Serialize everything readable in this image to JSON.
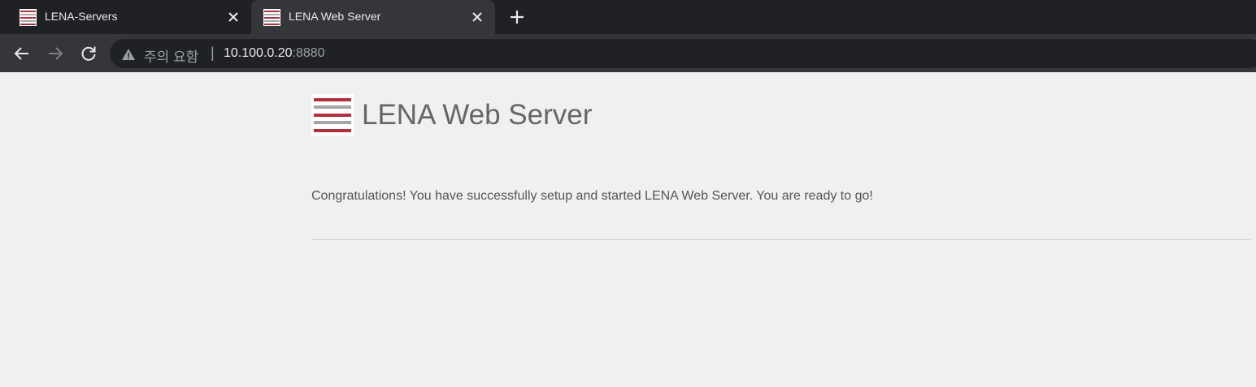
{
  "browser": {
    "tabs": [
      {
        "title": "LENA-Servers",
        "active": false,
        "favicon": "lena-logo-icon"
      },
      {
        "title": "LENA Web Server",
        "active": true,
        "favicon": "lena-logo-icon"
      }
    ],
    "address_bar": {
      "security_label": "주의 요함",
      "separator": "|",
      "url_host": "10.100.0.20",
      "url_port": ":8880"
    },
    "colors": {
      "tabbar_bg": "#202124",
      "toolbar_bg": "#35363a",
      "logo_red": "#b0303f",
      "logo_gray": "#a6a6a6"
    }
  },
  "page": {
    "title": "LENA Web Server",
    "message": "Congratulations! You have successfully setup and started LENA Web Server. You are ready to go!"
  }
}
